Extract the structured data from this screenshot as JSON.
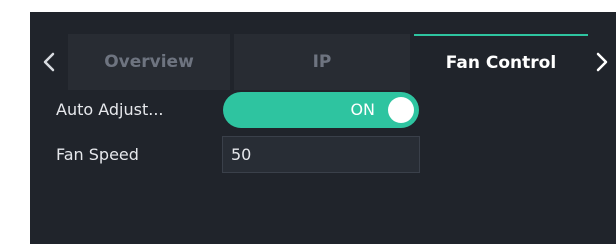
{
  "tabs": {
    "prev_icon": "chevron-left-icon",
    "next_icon": "chevron-right-icon",
    "items": [
      {
        "label": "Overview",
        "active": false
      },
      {
        "label": "IP",
        "active": false
      },
      {
        "label": "Fan Control",
        "active": true
      }
    ]
  },
  "fan_control": {
    "auto_adjust": {
      "label": "Auto Adjust...",
      "state_text": "ON",
      "enabled": true
    },
    "fan_speed": {
      "label": "Fan Speed",
      "value": "50"
    }
  },
  "colors": {
    "accent": "#2ec4a0",
    "panel_bg": "#20242b",
    "inactive_tab_bg": "#282c33"
  }
}
